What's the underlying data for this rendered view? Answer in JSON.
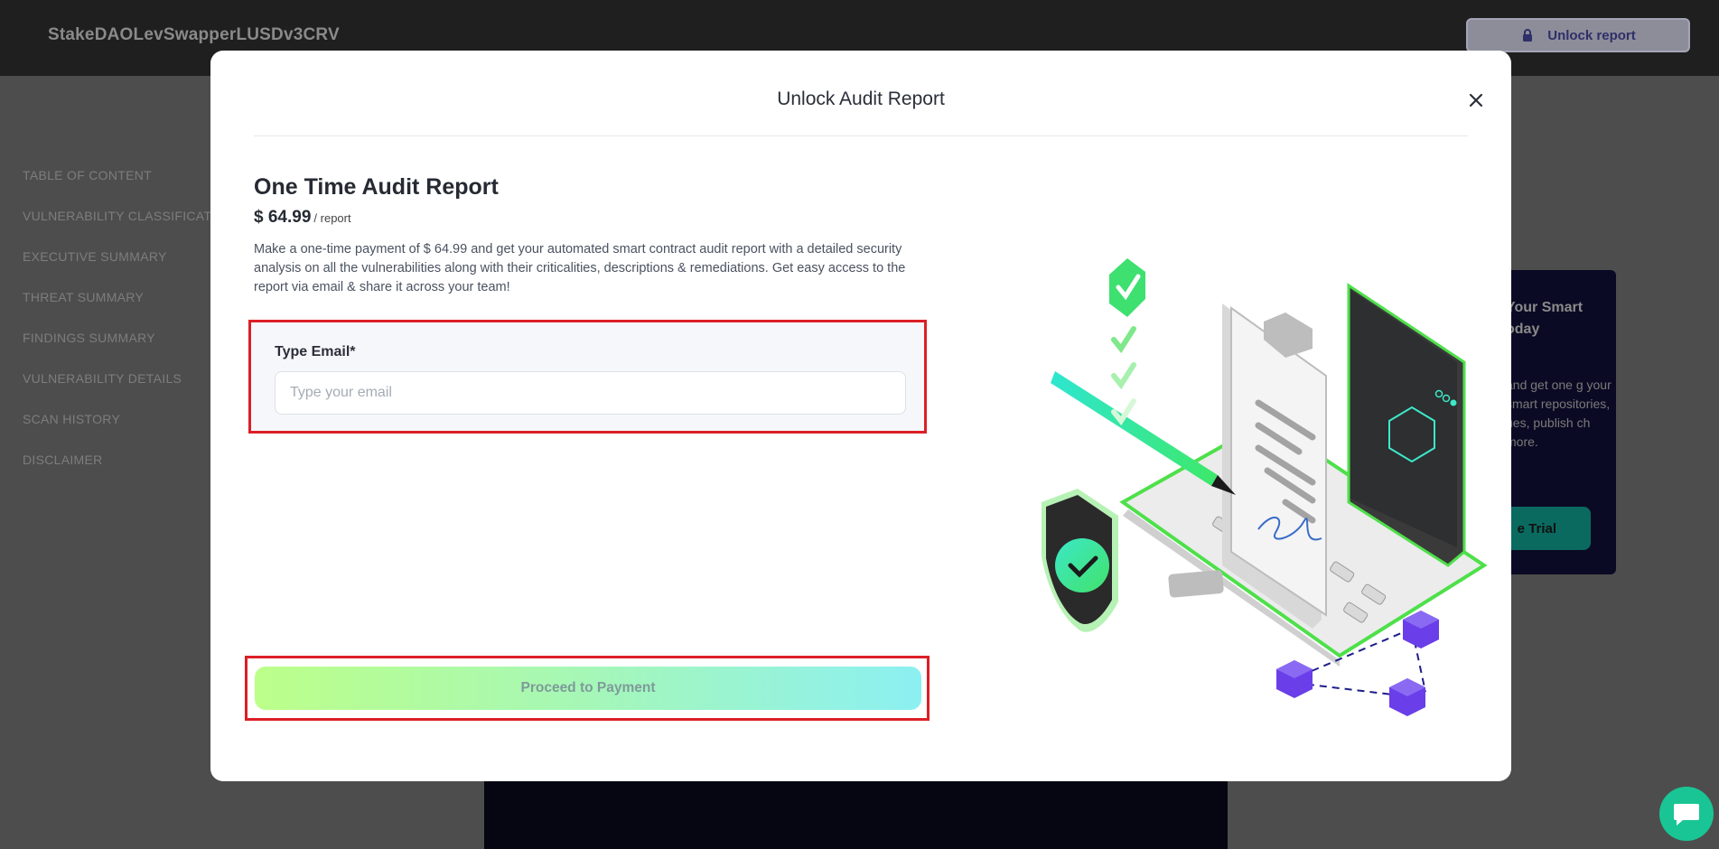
{
  "header": {
    "brand": "StakeDAOLevSwapperLUSDv3CRV",
    "unlock_label": "Unlock report"
  },
  "sidebar": {
    "items": [
      {
        "label": "TABLE OF CONTENT"
      },
      {
        "label": "VULNERABILITY CLASSIFICATION"
      },
      {
        "label": "EXECUTIVE SUMMARY"
      },
      {
        "label": "THREAT SUMMARY"
      },
      {
        "label": "FINDINGS SUMMARY"
      },
      {
        "label": "VULNERABILITY DETAILS"
      },
      {
        "label": "SCAN HISTORY"
      },
      {
        "label": "DISCLAIMER"
      }
    ]
  },
  "promo": {
    "title": "Your Smart oday",
    "description": "and get one g your smart repositories, ues, publish ch more.",
    "button_label": "e Trial"
  },
  "modal": {
    "title": "Unlock Audit Report",
    "plan_title": "One Time Audit Report",
    "price": "$ 64.99",
    "price_unit": "/ report",
    "description": "Make a one-time payment of $ 64.99 and get your automated smart contract audit report with a detailed security analysis on all the vulnerabilities along with their criticalities, descriptions & remediations. Get easy access to the report via email & share it across your team!",
    "email_label": "Type Email*",
    "email_value": "",
    "email_placeholder": "Type your email",
    "pay_label": "Proceed to Payment"
  },
  "colors": {
    "accent_green": "#19c594",
    "highlight_red": "#dc1f26",
    "pay_gradient_start": "#bcff8a",
    "pay_gradient_end": "#8cf0f2"
  }
}
